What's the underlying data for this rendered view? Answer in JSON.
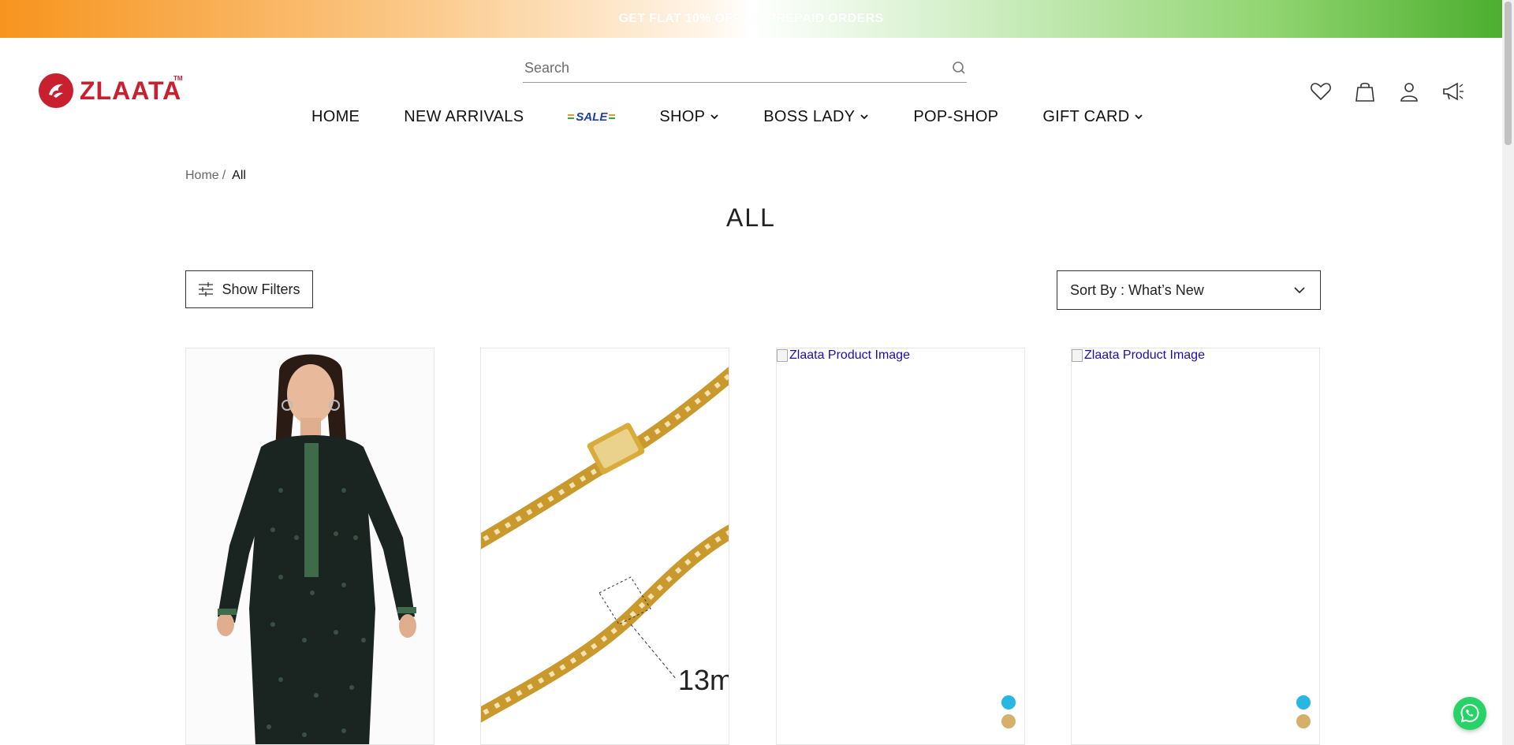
{
  "promo": {
    "text": "GET FLAT 10% OFF ON PREPAID ORDERS"
  },
  "brand": {
    "name": "ZLAATA",
    "trademark": "TM",
    "color": "#c8202f"
  },
  "search": {
    "placeholder": "Search",
    "value": ""
  },
  "nav": {
    "items": [
      {
        "label": "HOME",
        "has_dropdown": false
      },
      {
        "label": "NEW ARRIVALS",
        "has_dropdown": false
      },
      {
        "label": "SALE",
        "is_badge": true
      },
      {
        "label": "SHOP",
        "has_dropdown": true
      },
      {
        "label": "BOSS LADY",
        "has_dropdown": true
      },
      {
        "label": "POP-SHOP",
        "has_dropdown": false
      },
      {
        "label": "GIFT CARD",
        "has_dropdown": true
      }
    ]
  },
  "header_icons": [
    "heart-icon",
    "bag-icon",
    "user-icon",
    "megaphone-icon"
  ],
  "breadcrumb": {
    "home": "Home",
    "separator": "/",
    "current": "All"
  },
  "page": {
    "title": "ALL"
  },
  "controls": {
    "filters_label": "Show Filters",
    "sort_label": "Sort By : What’s New"
  },
  "products": [
    {
      "image_alt": "",
      "image": "kurta",
      "swatches": []
    },
    {
      "image_alt": "",
      "image": "chain",
      "chain_label": "13m",
      "swatches": []
    },
    {
      "image_alt": "Zlaata Product Image",
      "image": "broken",
      "swatches": [
        "#29b6e0",
        "#d4b06a"
      ]
    },
    {
      "image_alt": "Zlaata Product Image",
      "image": "broken",
      "swatches": [
        "#29b6e0",
        "#d4b06a"
      ]
    }
  ],
  "colors": {
    "promo_left": "#f7941d",
    "promo_right": "#4cae2e",
    "whatsapp": "#25d366"
  }
}
